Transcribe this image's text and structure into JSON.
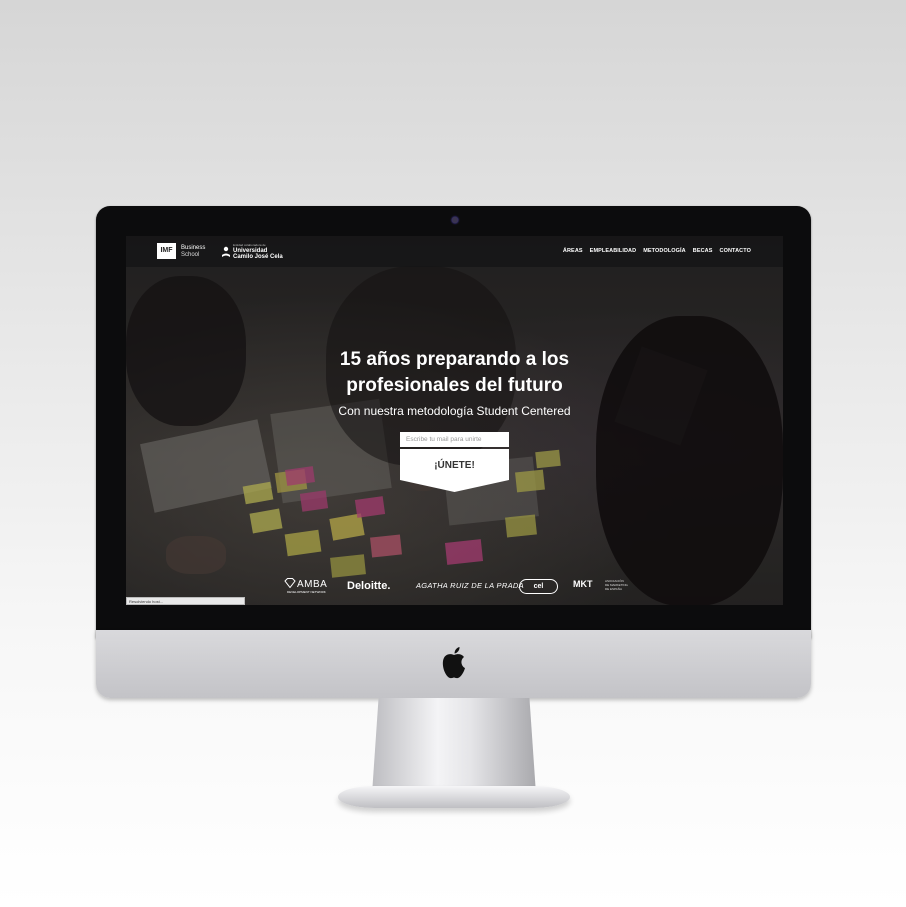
{
  "site": {
    "header": {
      "logo_imf": "IMF",
      "logo_business": "Business",
      "logo_school": "School",
      "logo_ucjc_small": "Entidad colaboradora de",
      "logo_ucjc_line1": "Universidad",
      "logo_ucjc_line2": "Camilo José Cela",
      "nav": [
        "ÁREAS",
        "EMPLEABILIDAD",
        "METODOLOGÍA",
        "BECAS",
        "CONTACTO"
      ]
    },
    "hero": {
      "title_line1": "15 años preparando a los",
      "title_line2": "profesionales del futuro",
      "subtitle": "Con nuestra metodología Student Centered",
      "email_placeholder": "Escribe tu mail para unirte",
      "join_label": "¡ÚNETE!"
    },
    "partners": {
      "amba": "AMBA",
      "amba_sub": "DEVELOPMENT NETWORK",
      "deloitte": "Deloitte.",
      "agatha": "AGATHA RUIZ DE LA PRADA",
      "cel": "cel",
      "mkt": "MKT",
      "mkt_sub": [
        "ASOCIACIÓN",
        "DE MARKETING",
        "DE ESPAÑA"
      ]
    },
    "status_text": "Resolviendo host..."
  },
  "colors": {
    "bezel": "#0c0c0d",
    "chin": "#c8c8cc",
    "header_bg": "#141416",
    "notes": [
      "#e7e36a",
      "#e0529a",
      "#f2a35c"
    ]
  },
  "icons": [
    "apple-logo-icon",
    "ucjc-emblem-icon",
    "amba-diamond-icon",
    "camera-dot"
  ]
}
